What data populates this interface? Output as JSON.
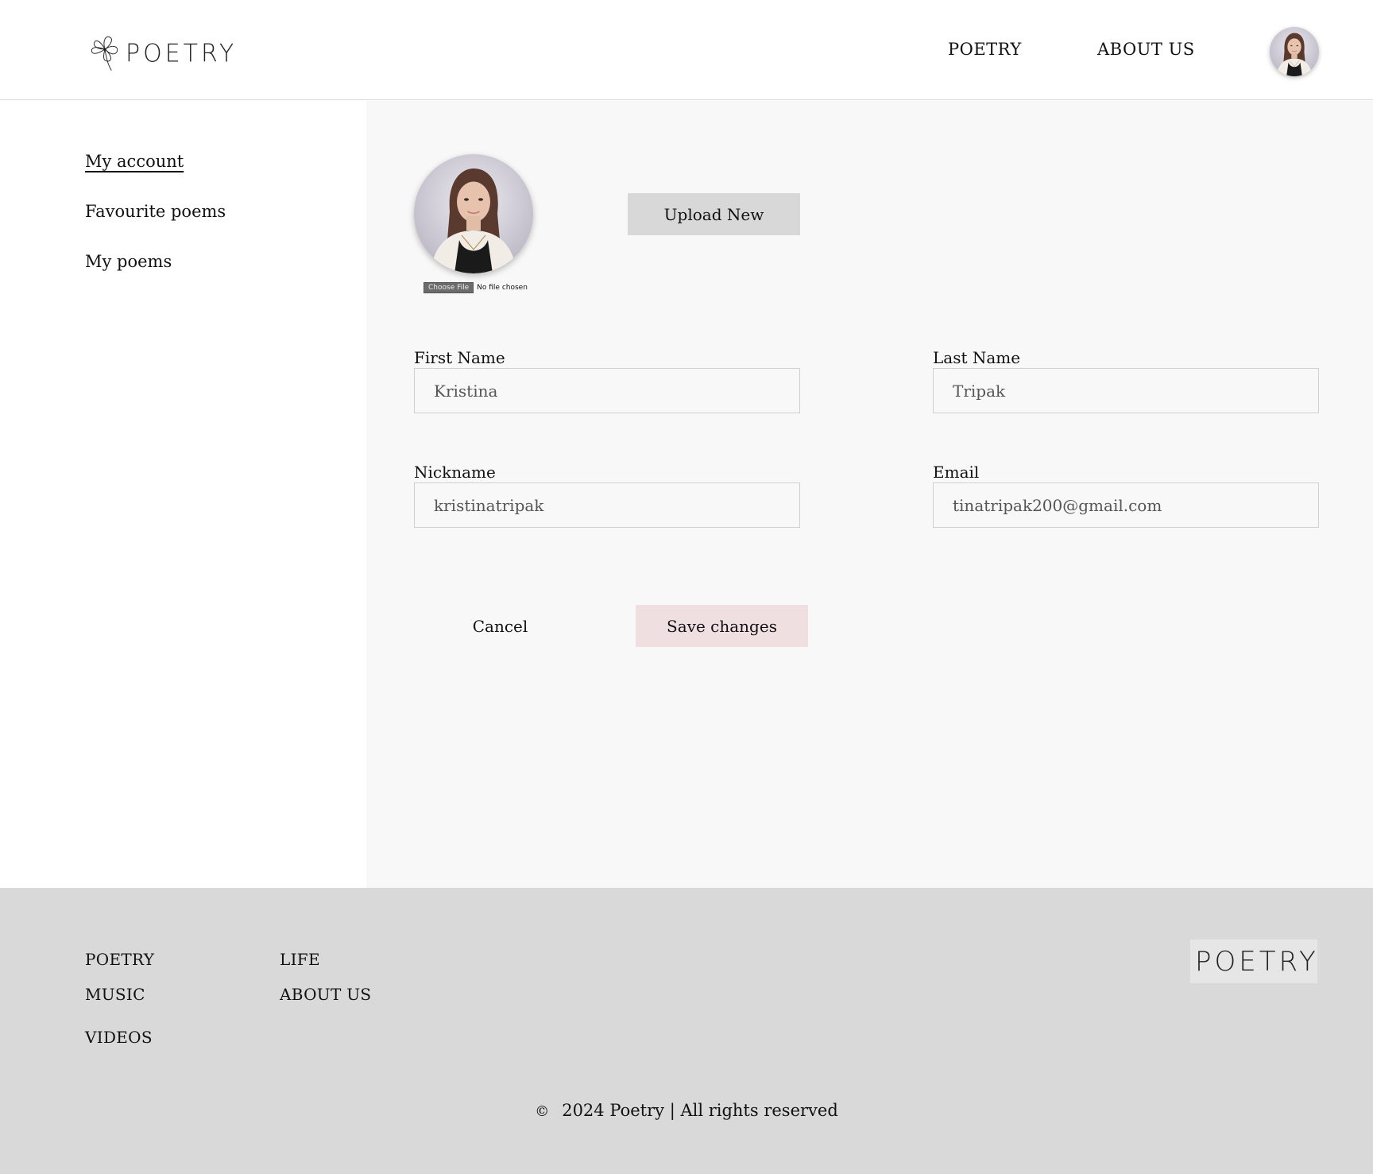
{
  "brand": {
    "logo_text": "POETRY",
    "logo_icon": "clover-flower-icon"
  },
  "header": {
    "nav": [
      {
        "label": "POETRY"
      },
      {
        "label": "ABOUT US"
      }
    ],
    "avatar": "user-avatar"
  },
  "sidebar": {
    "items": [
      {
        "label": "My account",
        "active": true
      },
      {
        "label": "Favourite poems"
      },
      {
        "label": "My poems"
      }
    ]
  },
  "profile": {
    "choose_file_label": "Choose File",
    "file_status": "No file chosen",
    "upload_label": "Upload New",
    "fields": {
      "first_name": {
        "label": "First Name",
        "value": "Kristina"
      },
      "last_name": {
        "label": "Last Name",
        "value": "Tripak"
      },
      "nickname": {
        "label": "Nickname",
        "value": "kristinatripak"
      },
      "email": {
        "label": "Email",
        "value": "tinatripak200@gmail.com"
      }
    },
    "cancel_label": "Cancel",
    "save_label": "Save changes"
  },
  "footer": {
    "col1": [
      {
        "label": "POETRY"
      },
      {
        "label": "MUSIC"
      },
      {
        "label": "VIDEOS"
      }
    ],
    "col2": [
      {
        "label": "LIFE"
      },
      {
        "label": "ABOUT US"
      }
    ],
    "copyright_symbol": "©",
    "copyright_text": "2024 Poetry | All rights reserved"
  },
  "colors": {
    "save_button": "#efdfe0",
    "upload_button": "#d8d8d8",
    "main_bg": "#f8f8f8",
    "footer_bg": "#d9d9d9"
  }
}
